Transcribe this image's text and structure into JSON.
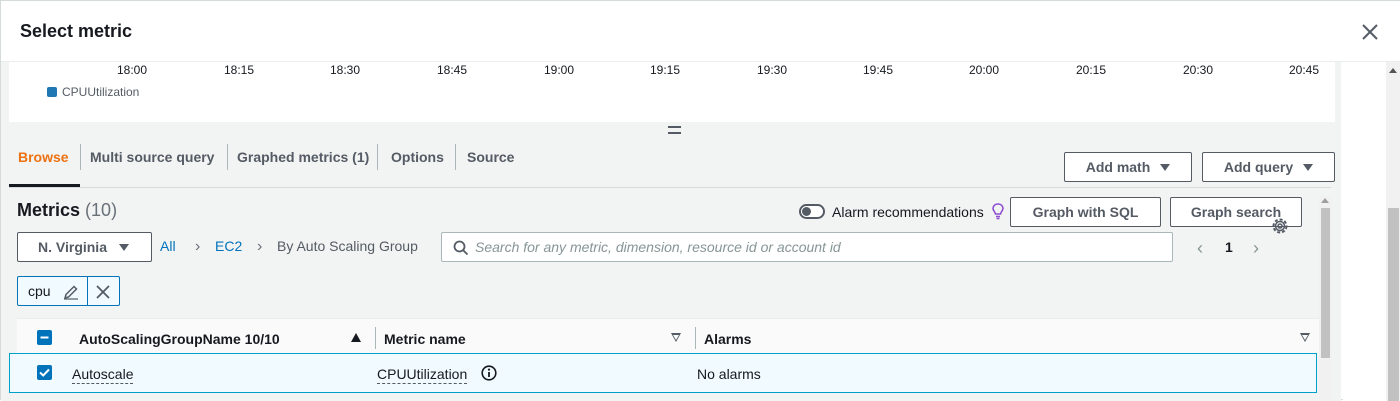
{
  "header": {
    "title": "Select metric"
  },
  "graph": {
    "x_ticks": [
      "18:00",
      "18:15",
      "18:30",
      "18:45",
      "19:00",
      "19:15",
      "19:30",
      "19:45",
      "20:00",
      "20:15",
      "20:30",
      "20:45"
    ],
    "legend_label": "CPUUtilization",
    "legend_color": "#1f77b4"
  },
  "tabs": [
    {
      "label": "Browse",
      "active": true
    },
    {
      "label": "Multi source query"
    },
    {
      "label": "Graphed metrics (1)"
    },
    {
      "label": "Options"
    },
    {
      "label": "Source"
    }
  ],
  "toolbar": {
    "add_math": "Add math",
    "add_query": "Add query"
  },
  "metrics": {
    "title": "Metrics",
    "count": "(10)",
    "alarm_recommendations_label": "Alarm recommendations",
    "graph_with_sql": "Graph with SQL",
    "graph_search": "Graph search"
  },
  "filter": {
    "region": "N. Virginia",
    "breadcrumbs": [
      "All",
      "EC2",
      "By Auto Scaling Group"
    ],
    "search_placeholder": "Search for any metric, dimension, resource id or account id",
    "page": "1",
    "token": "cpu"
  },
  "table": {
    "columns": [
      "AutoScalingGroupName 10/10",
      "Metric name",
      "Alarms"
    ],
    "rows": [
      {
        "group": "Autoscale",
        "metric": "CPUUtilization",
        "alarms": "No alarms",
        "selected": true
      }
    ]
  },
  "colors": {
    "accent": "#ec7211",
    "link": "#0073bb",
    "selected_border": "#00a1c9"
  }
}
